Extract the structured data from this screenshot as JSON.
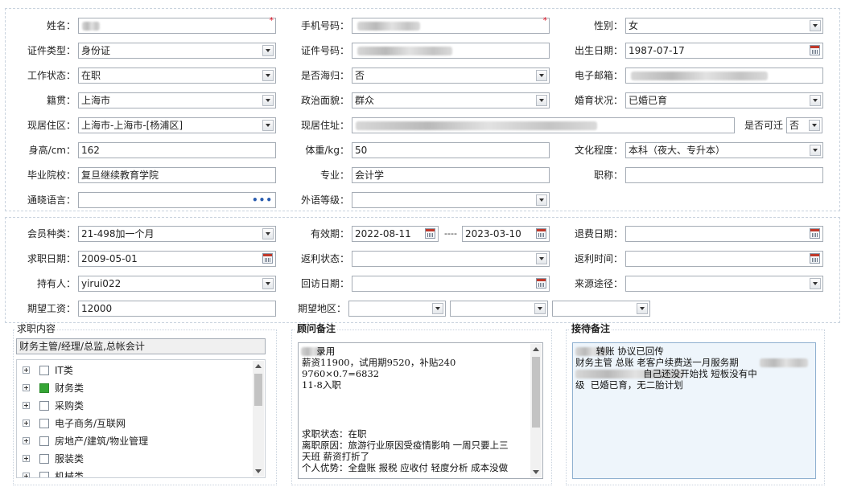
{
  "basic": {
    "name_label": "姓名：",
    "phone_label": "手机号码：",
    "gender_label": "性别：",
    "gender_value": "女",
    "idtype_label": "证件类型：",
    "idtype_value": "身份证",
    "idno_label": "证件号码：",
    "birth_label": "出生日期：",
    "birth_value": "1987-07-17",
    "workstatus_label": "工作状态：",
    "workstatus_value": "在职",
    "returnee_label": "是否海归：",
    "returnee_value": "否",
    "email_label": "电子邮箱：",
    "native_label": "籍贯：",
    "native_value": "上海市",
    "political_label": "政治面貌：",
    "political_value": "群众",
    "marital_label": "婚育状况：",
    "marital_value": "已婚已育",
    "district_label": "现居住区：",
    "district_value": "上海市-上海市-[杨浦区]",
    "address_label": "现居住址：",
    "relocate_label": "是否可迁",
    "relocate_value": "否",
    "height_label": "身高/cm：",
    "height_value": "162",
    "weight_label": "体重/kg：",
    "weight_value": "50",
    "education_label": "文化程度：",
    "education_value": "本科（夜大、专升本）",
    "school_label": "毕业院校：",
    "school_value": "复旦继续教育学院",
    "major_label": "专业：",
    "major_value": "会计学",
    "title_label": "职称：",
    "language_label": "通晓语言：",
    "foreign_label": "外语等级："
  },
  "membership": {
    "type_label": "会员种类：",
    "type_value": "21-498加一个月",
    "validity_label": "有效期：",
    "valid_from": "2022-08-11",
    "valid_sep": "----",
    "valid_to": "2023-03-10",
    "refund_date_label": "退费日期：",
    "job_date_label": "求职日期：",
    "job_date_value": "2009-05-01",
    "rebate_status_label": "返利状态：",
    "rebate_time_label": "返利时间：",
    "holder_label": "持有人：",
    "holder_value": "yirui022",
    "visit_date_label": "回访日期：",
    "source_label": "来源途径：",
    "salary_label": "期望工资：",
    "salary_value": "12000",
    "region_label": "期望地区："
  },
  "job_panel": {
    "legend": "求职内容",
    "summary": "财务主管/经理/总监,总帐会计",
    "items": [
      {
        "label": "IT类",
        "checked": false
      },
      {
        "label": "财务类",
        "checked": true
      },
      {
        "label": "采购类",
        "checked": false
      },
      {
        "label": "电子商务/互联网",
        "checked": false
      },
      {
        "label": "房地产/建筑/物业管理",
        "checked": false
      },
      {
        "label": "服装类",
        "checked": false
      },
      {
        "label": "机械类",
        "checked": false
      }
    ]
  },
  "advisor_panel": {
    "legend": "顾问备注",
    "lines": [
      "     录用",
      "薪资11900，试用期9520，补贴240",
      "9760×0.7=6832",
      "11-8入职",
      "",
      "",
      "",
      "求职状态：在职",
      "离职原因：旅游行业原因受疫情影响 一周只要上三",
      "天班 薪资打折了",
      "个人优势：全盘账 报税 应收付 轻度分析 成本没做"
    ]
  },
  "reception_panel": {
    "legend": "接待备注",
    "lines": [
      "       转账 协议已回传",
      "财务主管 总账 老客户续费送一月服务期",
      "                       自己还没开始找 短板没有中",
      "级  已婚已育，无二胎计划"
    ]
  },
  "colors": {
    "border": "#a5acb5",
    "section_border": "#c9d3de",
    "required": "#dd1122",
    "checked": "#35a535"
  },
  "icons": [
    "dropdown-arrow-icon",
    "calendar-icon",
    "more-dots-icon",
    "tree-expand-icon",
    "checkbox-icon"
  ]
}
